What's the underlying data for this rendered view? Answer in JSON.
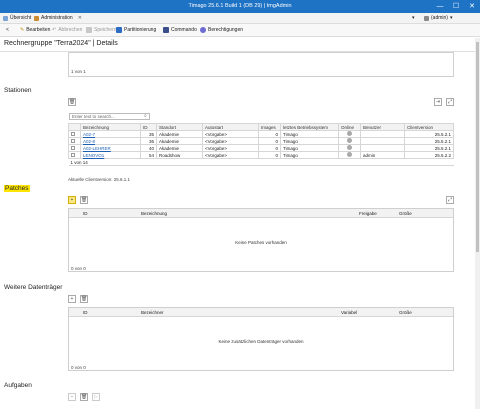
{
  "window": {
    "title": "Timago 25.6.1 Build 1 (DB 29) | tmgAdmin",
    "min": "—",
    "max": "☐",
    "close": "✕"
  },
  "tabs": [
    {
      "label": "Übersicht"
    },
    {
      "label": "Administration"
    }
  ],
  "tab_dropdown": "▾",
  "user": "(admin)",
  "toolbar": {
    "back": "<",
    "edit": "Bearbeiten",
    "cancel": "Abbrechen",
    "save": "Speichern",
    "partition": "Partitionierung",
    "command": "Commando",
    "permissions": "Berechtigungen"
  },
  "page_title": "Rechnergruppe \"Terra2024\" | Details",
  "top_panel": {
    "pager": "1 von 1"
  },
  "stations": {
    "title": "Stationen",
    "search_placeholder": "Enter text to search...",
    "columns": [
      "Bezeichnung",
      "ID",
      "Standort",
      "Autostart",
      "Images",
      "letztes Betriebssystem",
      "Online",
      "Benutzer",
      "Clientversion"
    ],
    "rows": [
      {
        "name": "A02-7",
        "id": "35",
        "location": "Akademie",
        "autostart": "<Vorgabe>",
        "images": "0",
        "os": "Timago",
        "user": "",
        "version": "25.5.2.1"
      },
      {
        "name": "A02-8",
        "id": "36",
        "location": "Akademie",
        "autostart": "<Vorgabe>",
        "images": "0",
        "os": "Timago",
        "user": "",
        "version": "25.5.2.1"
      },
      {
        "name": "A02-LEHRER",
        "id": "40",
        "location": "Akademie",
        "autostart": "<Vorgabe>",
        "images": "0",
        "os": "Timago",
        "user": "",
        "version": "25.5.2.1"
      },
      {
        "name": "LENOVO1",
        "id": "54",
        "location": "Roadshow",
        "autostart": "<Vorgabe>",
        "images": "0",
        "os": "Timago",
        "user": "admin",
        "version": "25.5.2.2"
      }
    ],
    "pager": "1 von 14",
    "current_version": "Aktuelle Clientversion: 25.6.1.1"
  },
  "patches": {
    "title": "Patches",
    "columns": [
      "ID",
      "Bezeichnung",
      "Freigabe",
      "Größe"
    ],
    "empty": "Keine Patches vorhanden",
    "pager": "0 von 0"
  },
  "datatraeger": {
    "title": "Weitere Datenträger",
    "columns": [
      "ID",
      "Bezeichner",
      "Variabel",
      "Größe"
    ],
    "empty": "Keine zusätzlichen Datenträger vorhanden",
    "pager": "0 von 0"
  },
  "aufgaben": {
    "title": "Aufgaben"
  },
  "colors": {
    "titlebar": "#1f73c4",
    "highlight": "#ffe500",
    "link": "#1a5fb4"
  }
}
